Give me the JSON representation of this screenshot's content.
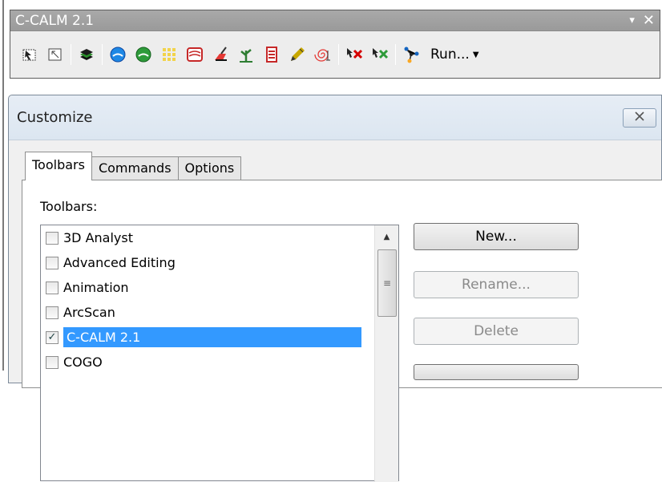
{
  "toolbar": {
    "title": "C-CALM 2.1",
    "menu_glyph": "▾",
    "close_glyph": "✕",
    "run_label": "Run...",
    "icons": [
      "select-features-icon",
      "select-elements-icon",
      "layers-icon",
      "blue-circle-icon",
      "green-circle-icon",
      "grid-icon",
      "contour-icon",
      "broom-icon",
      "plant-icon",
      "list-icon",
      "pencil-icon",
      "spiral-icon",
      "delete-red-icon",
      "delete-green-icon",
      "network-icon"
    ]
  },
  "dialog": {
    "title": "Customize",
    "close_label": "⊠",
    "tabs": [
      {
        "label": "Toolbars",
        "active": true
      },
      {
        "label": "Commands"
      },
      {
        "label": "Options"
      }
    ],
    "list_label": "Toolbars:",
    "items": [
      {
        "label": "3D Analyst",
        "checked": false
      },
      {
        "label": "Advanced Editing",
        "checked": false
      },
      {
        "label": "Animation",
        "checked": false
      },
      {
        "label": "ArcScan",
        "checked": false
      },
      {
        "label": "C-CALM 2.1",
        "checked": true,
        "selected": true
      },
      {
        "label": "COGO",
        "checked": false
      }
    ],
    "buttons": {
      "new": "New...",
      "rename": "Rename...",
      "delete": "Delete"
    }
  }
}
